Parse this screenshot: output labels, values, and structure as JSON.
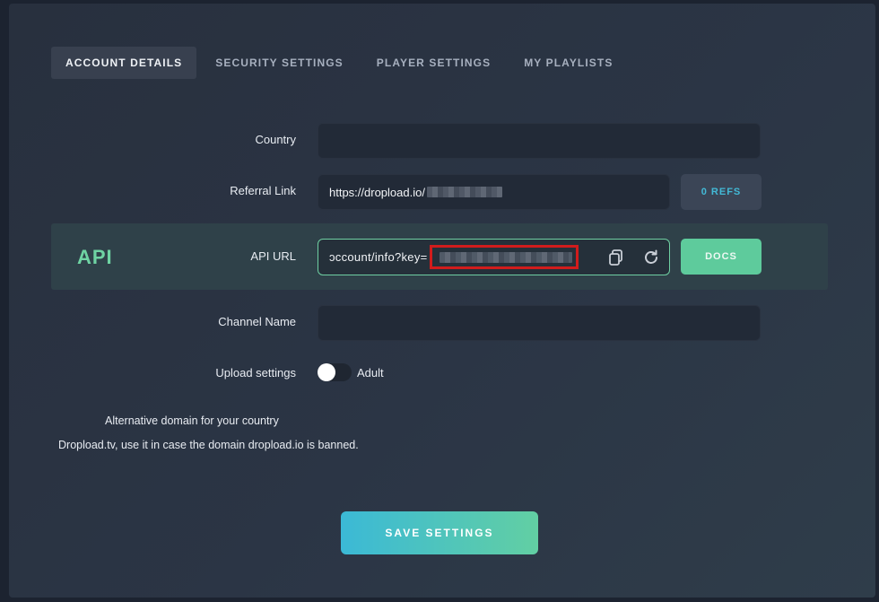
{
  "tabs": [
    {
      "label": "ACCOUNT DETAILS",
      "active": true
    },
    {
      "label": "SECURITY SETTINGS",
      "active": false
    },
    {
      "label": "PLAYER SETTINGS",
      "active": false
    },
    {
      "label": "MY PLAYLISTS",
      "active": false
    }
  ],
  "country": {
    "label": "Country",
    "value": ""
  },
  "referral": {
    "label": "Referral Link",
    "value": "https://dropload.io/",
    "refs_button": "0 REFS"
  },
  "api": {
    "section_title": "API",
    "label": "API URL",
    "value": "ɔccount/info?key=",
    "copy_icon": "copy-icon",
    "refresh_icon": "refresh-icon",
    "docs_button": "DOCS"
  },
  "channel": {
    "label": "Channel Name",
    "value": ""
  },
  "upload": {
    "label": "Upload settings",
    "toggle_label": "Adult",
    "toggle_on": false
  },
  "alt_domain": {
    "line1": "Alternative domain for your country",
    "line2": "Dropload.tv, use it in case the domain dropload.io is banned."
  },
  "save_button": "SAVE SETTINGS",
  "colors": {
    "accent_green": "#5ecb9c",
    "accent_blue": "#3bb9d6",
    "highlight_red": "#d11c1c"
  }
}
